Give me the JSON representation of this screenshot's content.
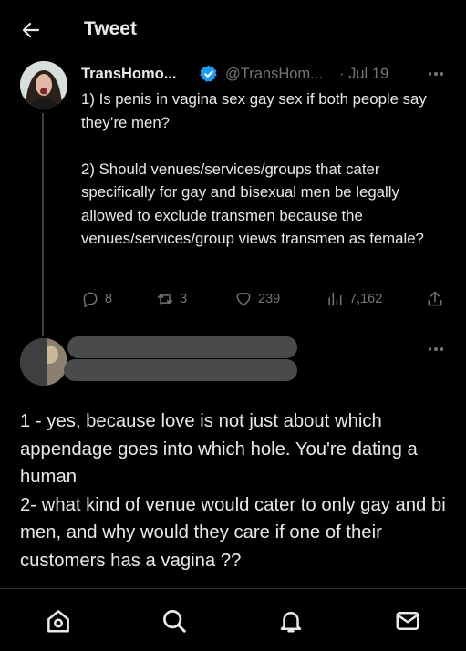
{
  "header": {
    "title": "Tweet"
  },
  "tweet": {
    "author_name": "TransHomo...",
    "author_handle": "@TransHom...",
    "separator": "·",
    "date": "Jul 19",
    "text": "1) Is penis in vagina sex gay sex if both people say they’re men?\n\n2) Should venues/services/groups that cater specifically for gay and bisexual men be legally allowed to exclude transmen because the venues/services/group views transmen as female?",
    "stats": {
      "replies": "8",
      "retweets": "3",
      "likes": "239",
      "views": "7,162"
    }
  },
  "reply": {
    "text": "1 - yes, because love is not just about which appendage goes into which hole. You're dating a human\n2- what kind of venue would cater to only gay and bi men, and why would they care if one of their customers has a vagina ??"
  },
  "colors": {
    "background": "#000000",
    "text": "#e7e9ea",
    "muted": "#71767b",
    "verified": "#1d9bf0"
  },
  "icons": {
    "back": "arrow-left-icon",
    "verified": "verified-badge-icon",
    "more": "more-icon",
    "reply": "reply-icon",
    "retweet": "retweet-icon",
    "like": "heart-icon",
    "views": "views-icon",
    "share": "share-icon",
    "nav": [
      "home-icon",
      "search-icon",
      "notifications-icon",
      "messages-icon"
    ]
  }
}
